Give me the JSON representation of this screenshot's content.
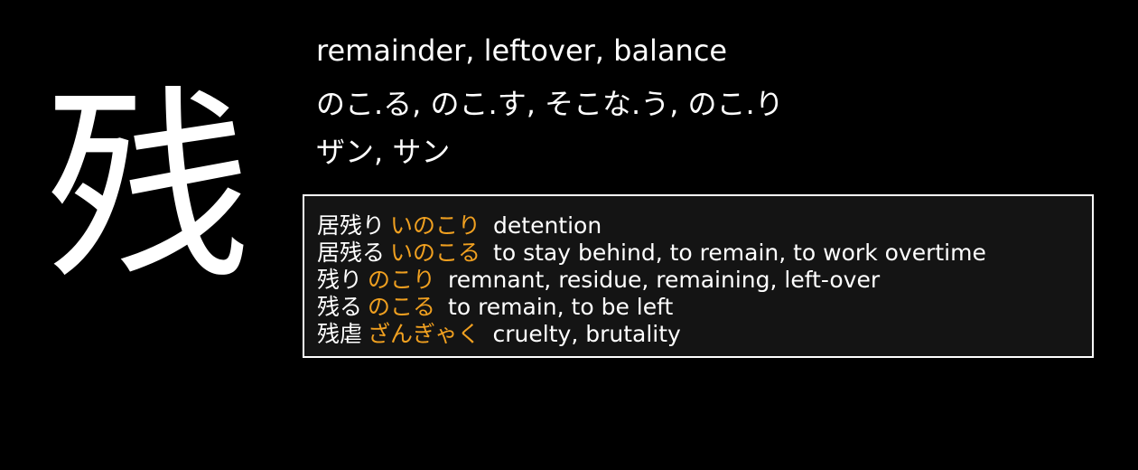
{
  "kanji": "残",
  "meaning": "remainder, leftover, balance",
  "kun_readings": "のこ.る, のこ.す, そこな.う, のこ.り",
  "on_readings": "ザン, サン",
  "colors": {
    "background": "#000000",
    "text": "#ffffff",
    "reading_accent": "#f0a020",
    "vocab_box_background": "#141414",
    "vocab_box_border": "#ffffff"
  },
  "vocab": [
    {
      "word": "居残り",
      "reading": "いのこり",
      "meaning": "detention"
    },
    {
      "word": "居残る",
      "reading": "いのこる",
      "meaning": "to stay behind, to remain, to work overtime"
    },
    {
      "word": "残り",
      "reading": "のこり",
      "meaning": "remnant, residue, remaining, left-over"
    },
    {
      "word": "残る",
      "reading": "のこる",
      "meaning": "to remain, to be left"
    },
    {
      "word": "残虐",
      "reading": "ざんぎゃく",
      "meaning": "cruelty, brutality"
    }
  ]
}
